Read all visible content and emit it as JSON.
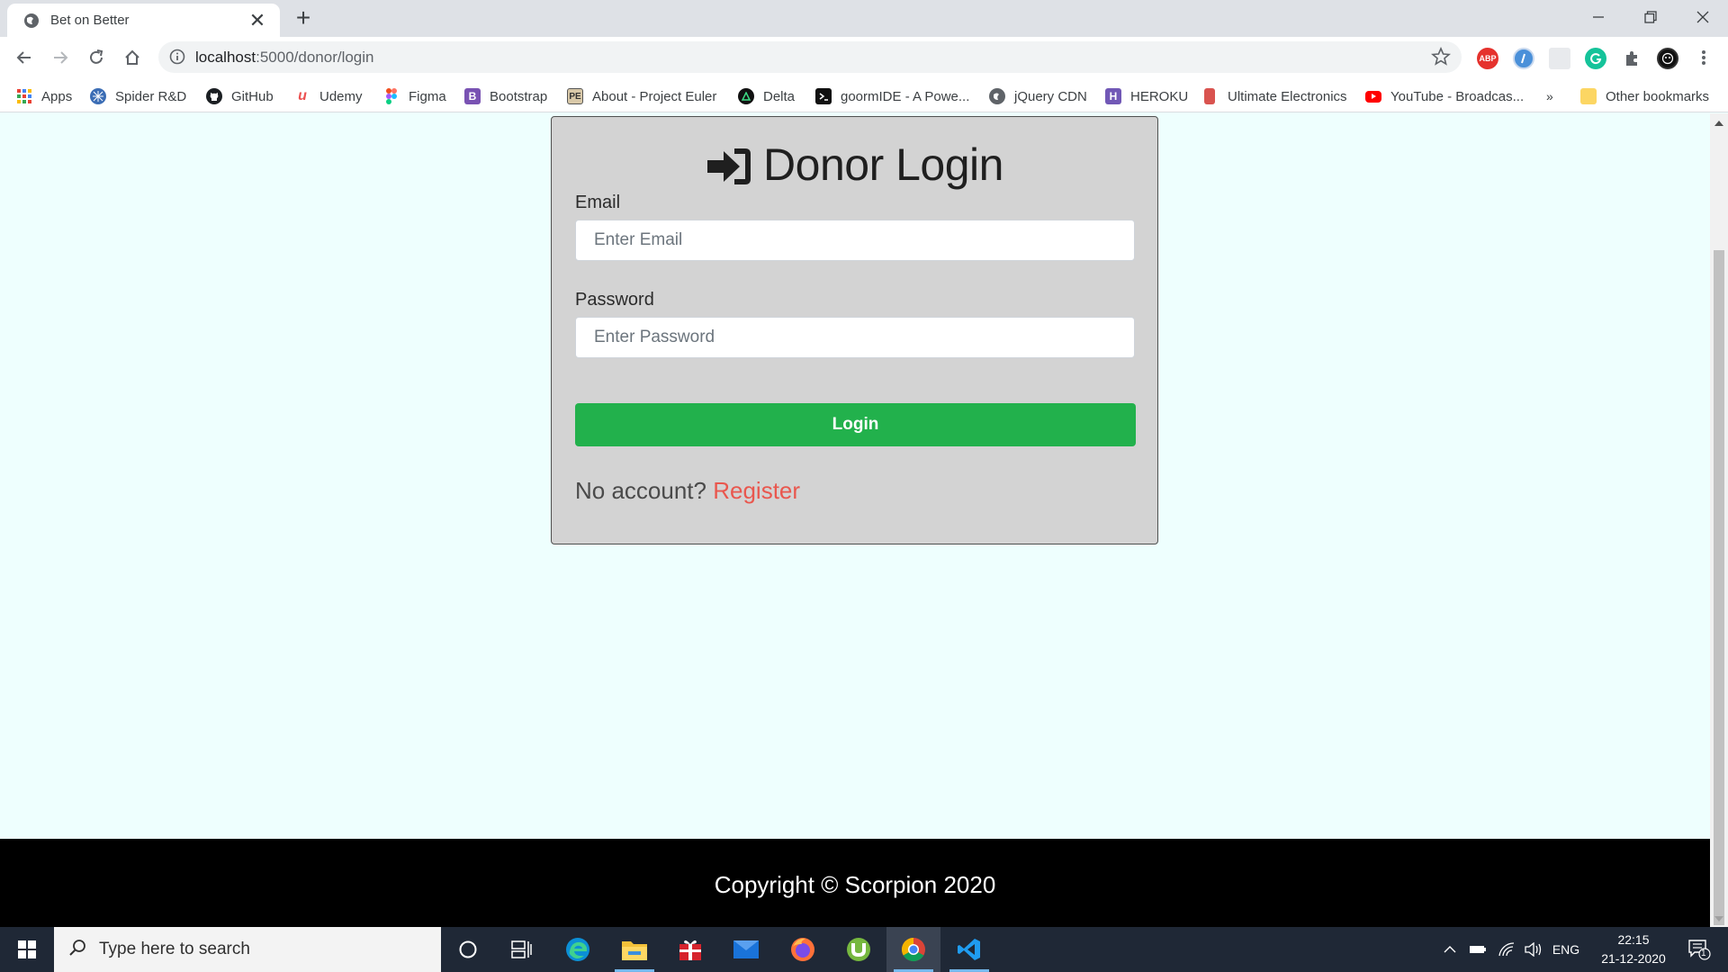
{
  "browser": {
    "tab_title": "Bet on Better",
    "new_tab_symbol": "+",
    "close_symbol": "✕",
    "url_host": "localhost",
    "url_path": ":5000/donor/login"
  },
  "bookmarks": [
    {
      "label": "Apps",
      "icon": "apps-grid-icon"
    },
    {
      "label": "Spider R&D",
      "icon": "spider-icon"
    },
    {
      "label": "GitHub",
      "icon": "github-icon"
    },
    {
      "label": "Udemy",
      "icon": "udemy-icon"
    },
    {
      "label": "Figma",
      "icon": "figma-icon"
    },
    {
      "label": "Bootstrap",
      "icon": "bootstrap-icon"
    },
    {
      "label": "About - Project Euler",
      "icon": "project-euler-icon"
    },
    {
      "label": "Delta",
      "icon": "delta-icon"
    },
    {
      "label": "goormIDE - A Powe...",
      "icon": "terminal-icon"
    },
    {
      "label": "jQuery CDN",
      "icon": "globe-icon"
    },
    {
      "label": "HEROKU",
      "icon": "heroku-icon"
    },
    {
      "label": "Ultimate Electronics",
      "icon": "book-icon"
    },
    {
      "label": "YouTube - Broadcas...",
      "icon": "youtube-icon"
    }
  ],
  "bookmarks_overflow": "»",
  "other_bookmarks": "Other bookmarks",
  "extensions": {
    "abp": "ABP"
  },
  "card": {
    "title": "Donor Login",
    "email_label": "Email",
    "email_placeholder": "Enter Email",
    "email_value": "",
    "password_label": "Password",
    "password_placeholder": "Enter Password",
    "password_value": "",
    "login_button": "Login",
    "no_account_text": "No account?",
    "register_link": "Register"
  },
  "footer": {
    "copyright": "Copyright © Scorpion 2020"
  },
  "taskbar": {
    "search_placeholder": "Type here to search",
    "language": "ENG",
    "time": "22:15",
    "date": "21-12-2020",
    "notification_count": "1"
  },
  "colors": {
    "page_bg": "#eefffe",
    "card_bg": "#d3d3d3",
    "login_button": "#22b14c",
    "register_link": "#e9574e",
    "footer_bg": "#000000"
  }
}
